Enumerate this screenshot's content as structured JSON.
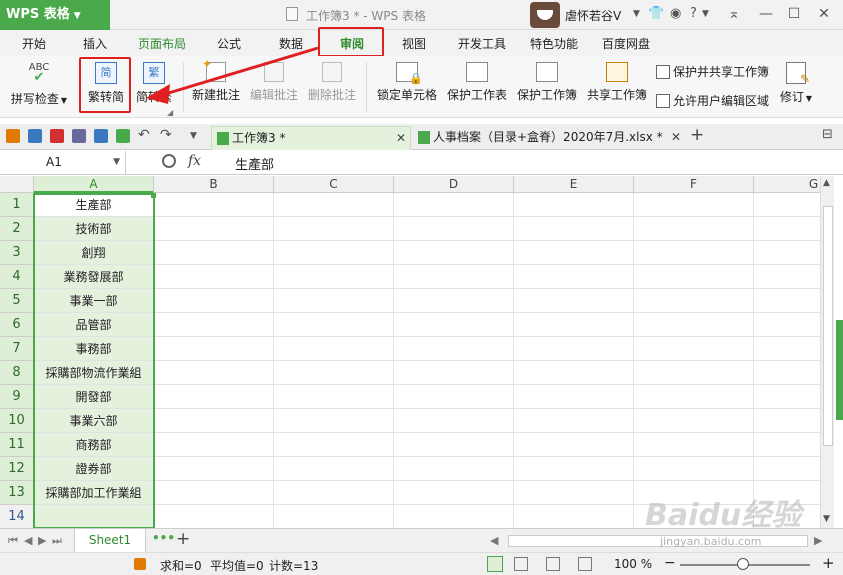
{
  "app": {
    "logo": "WPS 表格",
    "window_title": "工作簿3 * - WPS 表格",
    "user_name": "虐怀若谷V"
  },
  "menu_tabs": [
    "开始",
    "插入",
    "页面布局",
    "公式",
    "数据",
    "审阅",
    "视图",
    "开发工具",
    "特色功能",
    "百度网盘"
  ],
  "ribbon": {
    "spell_check": "拼写检查",
    "trad_to_simp": "繁转简",
    "simp_to_trad": "简转繁",
    "new_comment": "新建批注",
    "edit_comment": "编辑批注",
    "delete_comment": "删除批注",
    "lock_cell": "锁定单元格",
    "protect_sheet": "保护工作表",
    "protect_book": "保护工作簿",
    "share_book": "共享工作簿",
    "protect_share_book": "保护并共享工作簿",
    "allow_edit_ranges": "允许用户编辑区域",
    "revise": "修订",
    "abc_icon_text": "ABC",
    "trad_icon_char": "简",
    "simp_icon_char": "繁"
  },
  "doc_tabs": [
    {
      "label": "工作簿3 *",
      "active": true
    },
    {
      "label": "人事档案（目录+盒脊）2020年7月.xlsx *",
      "active": false
    }
  ],
  "formula_bar": {
    "name_box": "A1",
    "fx": "fx",
    "value": "生產部"
  },
  "columns": [
    "A",
    "B",
    "C",
    "D",
    "E",
    "F",
    "G"
  ],
  "rows": [
    {
      "num": "1",
      "a": "生產部"
    },
    {
      "num": "2",
      "a": "技術部"
    },
    {
      "num": "3",
      "a": "創翔"
    },
    {
      "num": "4",
      "a": "業務發展部"
    },
    {
      "num": "5",
      "a": "事業一部"
    },
    {
      "num": "6",
      "a": "品管部"
    },
    {
      "num": "7",
      "a": "事務部"
    },
    {
      "num": "8",
      "a": "採購部物流作業組"
    },
    {
      "num": "9",
      "a": "開發部"
    },
    {
      "num": "10",
      "a": "事業六部"
    },
    {
      "num": "11",
      "a": "商務部"
    },
    {
      "num": "12",
      "a": "證券部"
    },
    {
      "num": "13",
      "a": "採購部加工作業組"
    },
    {
      "num": "14",
      "a": ""
    }
  ],
  "sheet": {
    "name": "Sheet1"
  },
  "status": {
    "sum": "求和=0",
    "average": "平均值=0",
    "count": "计数=13",
    "zoom": "100 %"
  },
  "watermark": {
    "main": "Baidu经验",
    "sub": "jingyan.baidu.com"
  },
  "colors": {
    "accent": "#4aa94a",
    "highlight": "#e02020"
  }
}
